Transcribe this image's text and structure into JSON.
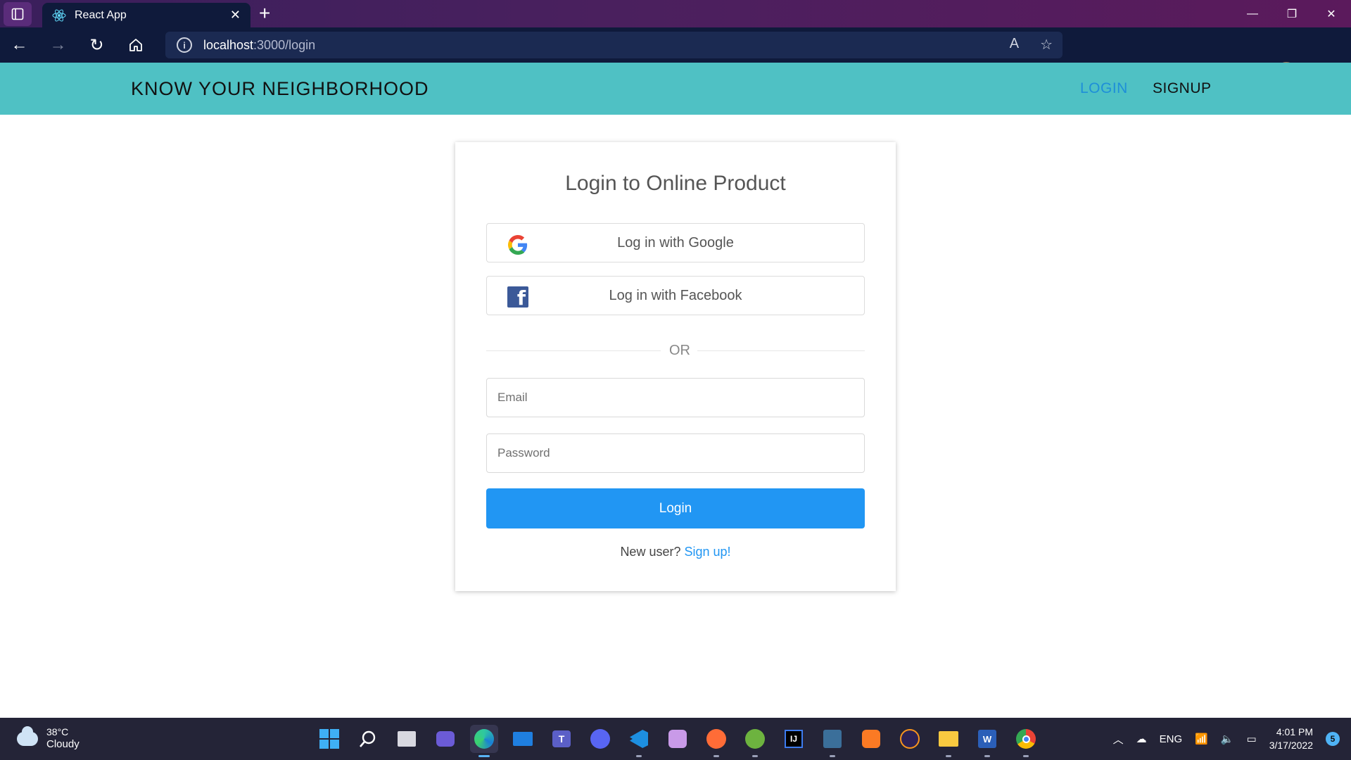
{
  "browser": {
    "tab_title": "React App",
    "tab_close": "✕",
    "new_tab": "+",
    "url_host": "localhost",
    "url_path": ":3000/login",
    "minimize": "—",
    "restore": "❐",
    "close": "✕"
  },
  "header": {
    "brand": "KNOW YOUR NEIGHBORHOOD",
    "nav_login": "LOGIN",
    "nav_signup": "SIGNUP",
    "bg_color": "#4fc1c4",
    "active_link_color": "#1e8fd8"
  },
  "login": {
    "title": "Login to Online Product",
    "google_label": "Log in with Google",
    "facebook_label": "Log in with Facebook",
    "or_text": "OR",
    "email_placeholder": "Email",
    "password_placeholder": "Password",
    "submit_label": "Login",
    "new_user_text": "New user?",
    "signup_link": "Sign up!",
    "accent_color": "#2196f3"
  },
  "taskbar": {
    "temperature": "38°C",
    "condition": "Cloudy",
    "language": "ENG",
    "time": "4:01 PM",
    "date": "3/17/2022",
    "notifications": "5",
    "apps": [
      "start-icon",
      "search-icon",
      "task-view-icon",
      "chat-icon",
      "edge-icon",
      "mail-icon",
      "teams-icon",
      "discord-icon",
      "vscode-icon",
      "app-icon",
      "postman-icon",
      "spring-icon",
      "intellij-icon",
      "mysql-icon",
      "xampp-icon",
      "eclipse-icon",
      "file-explorer-icon",
      "word-icon",
      "chrome-icon"
    ]
  }
}
